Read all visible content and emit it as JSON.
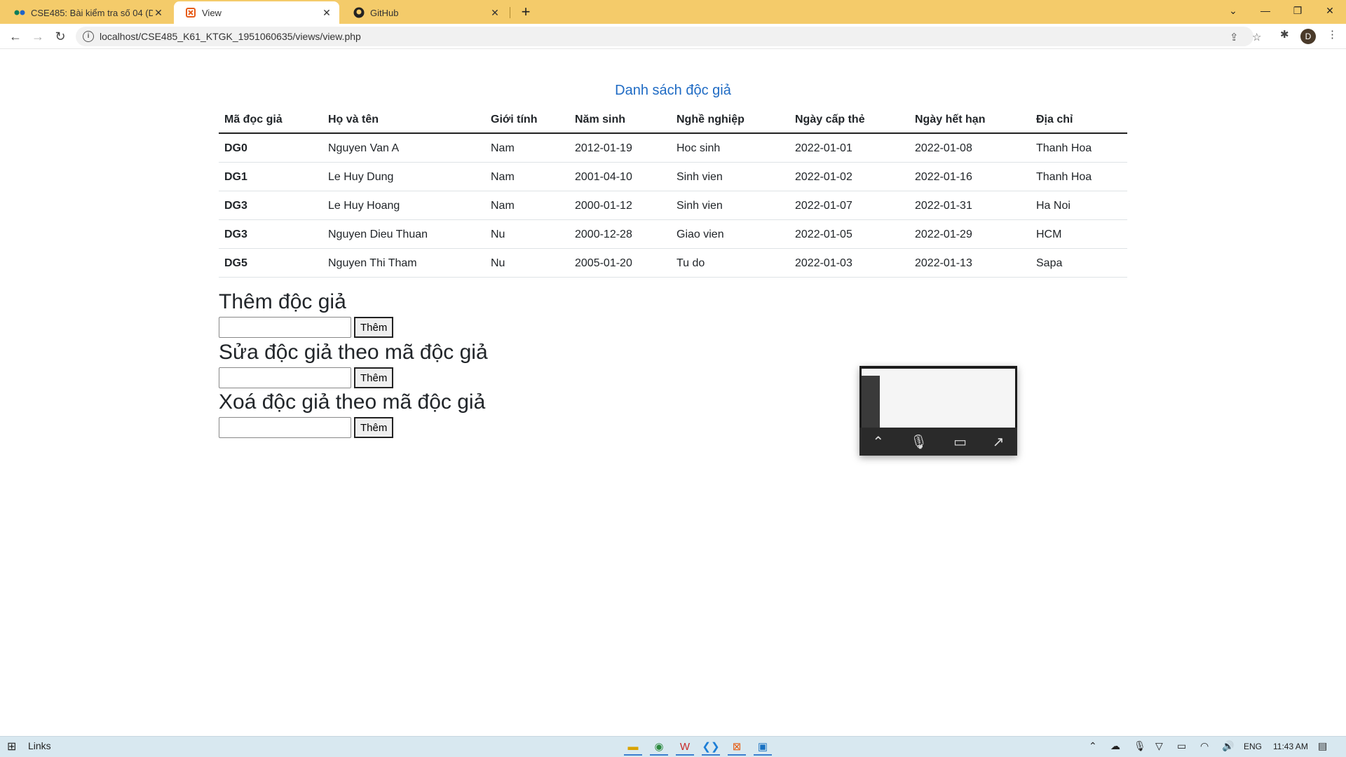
{
  "browser": {
    "tabs": [
      {
        "title": "CSE485: Bài kiểm tra số 04 (Dành",
        "icon": "meet-icon",
        "active": false
      },
      {
        "title": "View",
        "icon": "xampp-icon",
        "active": true
      },
      {
        "title": "GitHub",
        "icon": "github-icon",
        "active": false
      }
    ],
    "new_tab_glyph": "+",
    "url": "localhost/CSE485_K61_KTGK_1951060635/views/view.php",
    "profile_initial": "D"
  },
  "page": {
    "table_title": "Danh sách độc giả",
    "columns": [
      "Mã đọc giả",
      "Họ và tên",
      "Giới tính",
      "Năm sinh",
      "Nghề nghiệp",
      "Ngày cấp thẻ",
      "Ngày hết hạn",
      "Địa chỉ"
    ],
    "rows": [
      [
        "DG0",
        "Nguyen Van A",
        "Nam",
        "2012-01-19",
        "Hoc sinh",
        "2022-01-01",
        "2022-01-08",
        "Thanh Hoa"
      ],
      [
        "DG1",
        "Le Huy Dung",
        "Nam",
        "2001-04-10",
        "Sinh vien",
        "2022-01-02",
        "2022-01-16",
        "Thanh Hoa"
      ],
      [
        "DG3",
        "Le Huy Hoang",
        "Nam",
        "2000-01-12",
        "Sinh vien",
        "2022-01-07",
        "2022-01-31",
        "Ha Noi"
      ],
      [
        "DG3",
        "Nguyen Dieu Thuan",
        "Nu",
        "2000-12-28",
        "Giao vien",
        "2022-01-05",
        "2022-01-29",
        "HCM"
      ],
      [
        "DG5",
        "Nguyen Thi Tham",
        "Nu",
        "2005-01-20",
        "Tu do",
        "2022-01-03",
        "2022-01-13",
        "Sapa"
      ]
    ],
    "forms": [
      {
        "heading": "Thêm độc giả",
        "value": "",
        "button": "Thêm"
      },
      {
        "heading": "Sửa độc giả theo mã độc giả",
        "value": "",
        "button": "Thêm"
      },
      {
        "heading": "Xoá độc giả theo mã độc giả",
        "value": "",
        "button": "Thêm"
      }
    ]
  },
  "taskbar": {
    "links_label": "Links",
    "language": "ENG",
    "time": "11:43 AM"
  },
  "colors": {
    "tabbar": "#f4cb6a",
    "title_blue": "#1f6bc4"
  }
}
